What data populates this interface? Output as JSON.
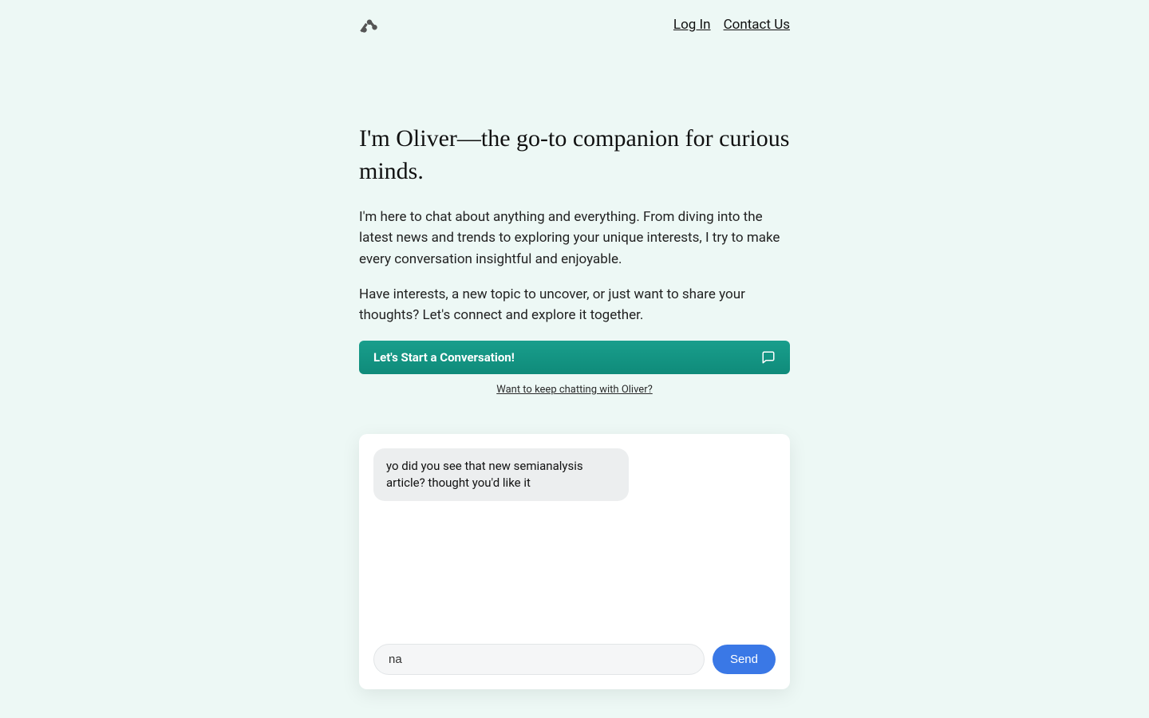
{
  "nav": {
    "login": "Log In",
    "contact": "Contact Us"
  },
  "hero": {
    "title": "I'm Oliver—the go-to companion for curious minds.",
    "p1": "I'm here to chat about anything and everything. From diving into the latest news and trends to exploring your unique interests, I try to make every conversation insightful and enjoyable.",
    "p2": "Have interests, a new topic to uncover, or just want to share your thoughts? Let's connect and explore it together."
  },
  "cta": {
    "label": "Let's Start a Conversation!"
  },
  "keep_chat_link": "Want to keep chatting with Oliver?",
  "chat": {
    "messages": [
      {
        "text": "yo did you see that new semianalysis article? thought you'd like it"
      }
    ],
    "input_value": "na",
    "send_label": "Send"
  }
}
